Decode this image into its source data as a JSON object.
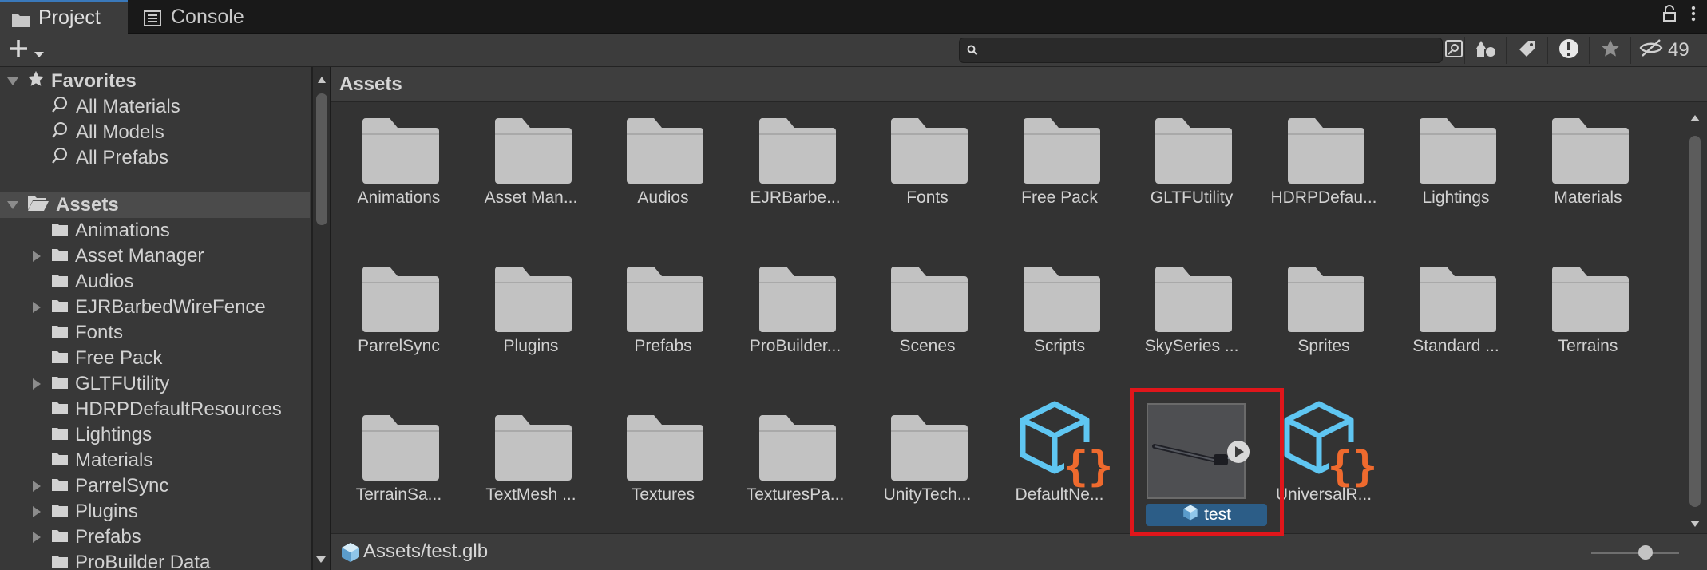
{
  "tabs": [
    {
      "label": "Project",
      "icon": "folder-icon",
      "active": true
    },
    {
      "label": "Console",
      "icon": "console-icon",
      "active": false
    }
  ],
  "toolbar": {
    "create_label": "+",
    "search_value": "",
    "search_placeholder": "",
    "hidden_packages_count": "49"
  },
  "sidebar": {
    "favorites": {
      "label": "Favorites",
      "items": [
        "All Materials",
        "All Models",
        "All Prefabs"
      ]
    },
    "assets": {
      "label": "Assets",
      "items": [
        {
          "label": "Animations",
          "expandable": false
        },
        {
          "label": "Asset Manager",
          "expandable": true
        },
        {
          "label": "Audios",
          "expandable": false
        },
        {
          "label": "EJRBarbedWireFence",
          "expandable": true
        },
        {
          "label": "Fonts",
          "expandable": false
        },
        {
          "label": "Free Pack",
          "expandable": false
        },
        {
          "label": "GLTFUtility",
          "expandable": true
        },
        {
          "label": "HDRPDefaultResources",
          "expandable": false
        },
        {
          "label": "Lightings",
          "expandable": false
        },
        {
          "label": "Materials",
          "expandable": false
        },
        {
          "label": "ParrelSync",
          "expandable": true
        },
        {
          "label": "Plugins",
          "expandable": true
        },
        {
          "label": "Prefabs",
          "expandable": true
        },
        {
          "label": "ProBuilder Data",
          "expandable": false
        }
      ]
    }
  },
  "main": {
    "breadcrumb": "Assets",
    "items": [
      {
        "label": "Animations",
        "kind": "folder"
      },
      {
        "label": "Asset Man...",
        "kind": "folder"
      },
      {
        "label": "Audios",
        "kind": "folder"
      },
      {
        "label": "EJRBarbe...",
        "kind": "folder"
      },
      {
        "label": "Fonts",
        "kind": "folder"
      },
      {
        "label": "Free Pack",
        "kind": "folder"
      },
      {
        "label": "GLTFUtility",
        "kind": "folder"
      },
      {
        "label": "HDRPDefau...",
        "kind": "folder"
      },
      {
        "label": "Lightings",
        "kind": "folder"
      },
      {
        "label": "Materials",
        "kind": "folder"
      },
      {
        "label": "ParrelSync",
        "kind": "folder"
      },
      {
        "label": "Plugins",
        "kind": "folder"
      },
      {
        "label": "Prefabs",
        "kind": "folder"
      },
      {
        "label": "ProBuilder...",
        "kind": "folder"
      },
      {
        "label": "Scenes",
        "kind": "folder"
      },
      {
        "label": "Scripts",
        "kind": "folder"
      },
      {
        "label": "SkySeries ...",
        "kind": "folder"
      },
      {
        "label": "Sprites",
        "kind": "folder"
      },
      {
        "label": "Standard ...",
        "kind": "folder"
      },
      {
        "label": "Terrains",
        "kind": "folder"
      },
      {
        "label": "TerrainSa...",
        "kind": "folder"
      },
      {
        "label": "TextMesh ...",
        "kind": "folder"
      },
      {
        "label": "Textures",
        "kind": "folder"
      },
      {
        "label": "TexturesPa...",
        "kind": "folder"
      },
      {
        "label": "UnityTech...",
        "kind": "folder"
      },
      {
        "label": "DefaultNe...",
        "kind": "asset-package"
      },
      {
        "label": "test",
        "kind": "model",
        "selected": true
      },
      {
        "label": "UniversalR...",
        "kind": "asset-package"
      }
    ],
    "status_path": "Assets/test.glb",
    "zoom_level": 0.62
  },
  "colors": {
    "selection_highlight": "#e0161b",
    "selected_label_bg": "#2c5d87",
    "folder": "#c2c2c2",
    "package_blue": "#5fc6f2",
    "package_orange": "#ef6a2e"
  }
}
